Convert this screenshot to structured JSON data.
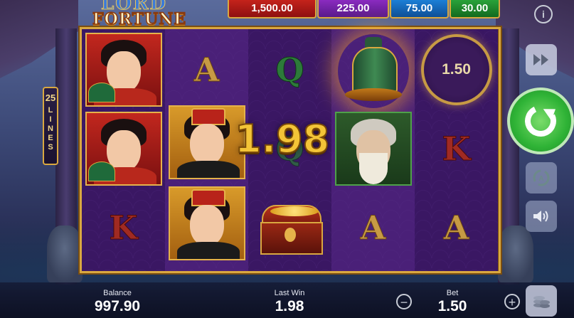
{
  "game": {
    "logo_line1": "LORD",
    "logo_line2": "FORTUNE"
  },
  "jackpots": [
    {
      "value": "1,500.00",
      "color": "#c4231b"
    },
    {
      "value": "225.00",
      "color": "#8a2bbf"
    },
    {
      "value": "75.00",
      "color": "#1c7fd6"
    },
    {
      "value": "30.00",
      "color": "#2aa23a"
    }
  ],
  "info_label": "i",
  "lines": {
    "count": "25",
    "label_letters": [
      "L",
      "I",
      "N",
      "E",
      "S"
    ]
  },
  "reels": {
    "letters": {
      "r2_top": "A",
      "r3_top": "Q",
      "r5_mid": "K",
      "r1_bot": "K",
      "r4_bot": "A",
      "r5_bot": "A"
    },
    "symbols": {
      "r1_top": "geisha",
      "r1_mid": "geisha",
      "r2_mid": "warrior",
      "r2_bot": "warrior",
      "r3_mid_partial": "Q",
      "r3_bot": "treasure-chest",
      "r4_top": "bronze-bell",
      "r4_mid": "old-sage",
      "r5_top": "coin"
    },
    "coin_value": "1.50"
  },
  "win_display": "1.98",
  "controls": {
    "turbo_icon": "fast-forward-icon",
    "spin_icon": "spin-arrow-icon",
    "autoplay_icon": "autoplay-icon",
    "sound_icon": "speaker-icon"
  },
  "bottom": {
    "balance_label": "Balance",
    "balance_value": "997.90",
    "last_win_label": "Last Win",
    "last_win_value": "1.98",
    "bet_label": "Bet",
    "bet_value": "1.50",
    "minus": "−",
    "plus": "+"
  }
}
